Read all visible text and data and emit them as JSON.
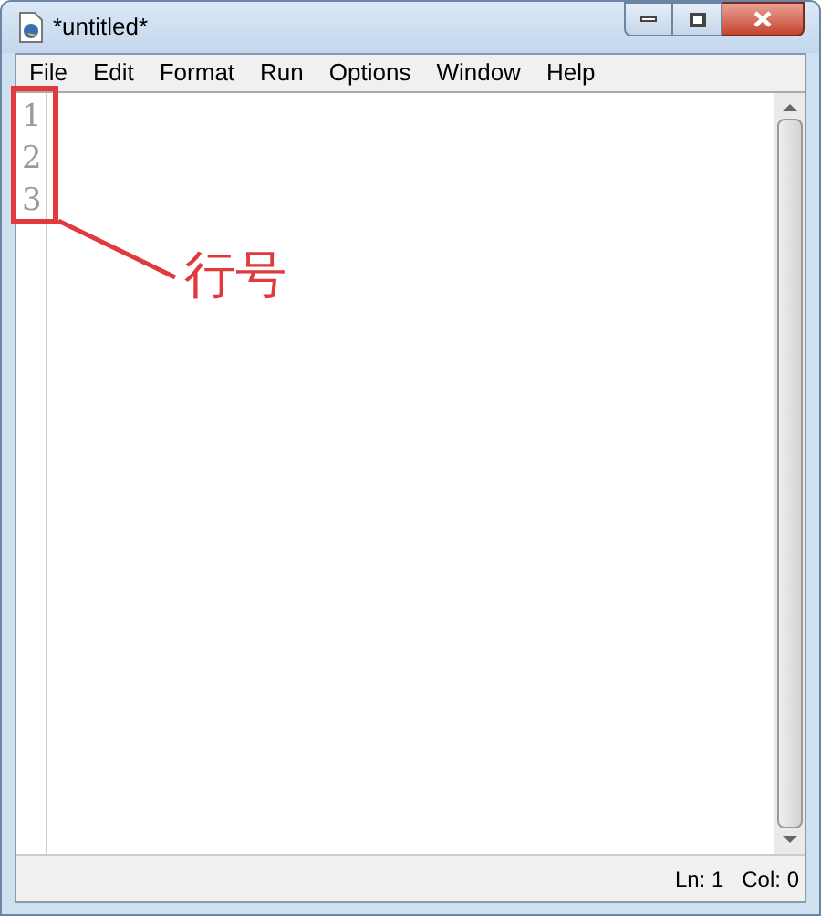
{
  "window": {
    "title": "*untitled*"
  },
  "menu": [
    "File",
    "Edit",
    "Format",
    "Run",
    "Options",
    "Window",
    "Help"
  ],
  "line_numbers": [
    "1",
    "2",
    "3"
  ],
  "annotation": {
    "label": "行号"
  },
  "status_bar": {
    "line": "Ln: 1",
    "column": "Col: 0"
  }
}
